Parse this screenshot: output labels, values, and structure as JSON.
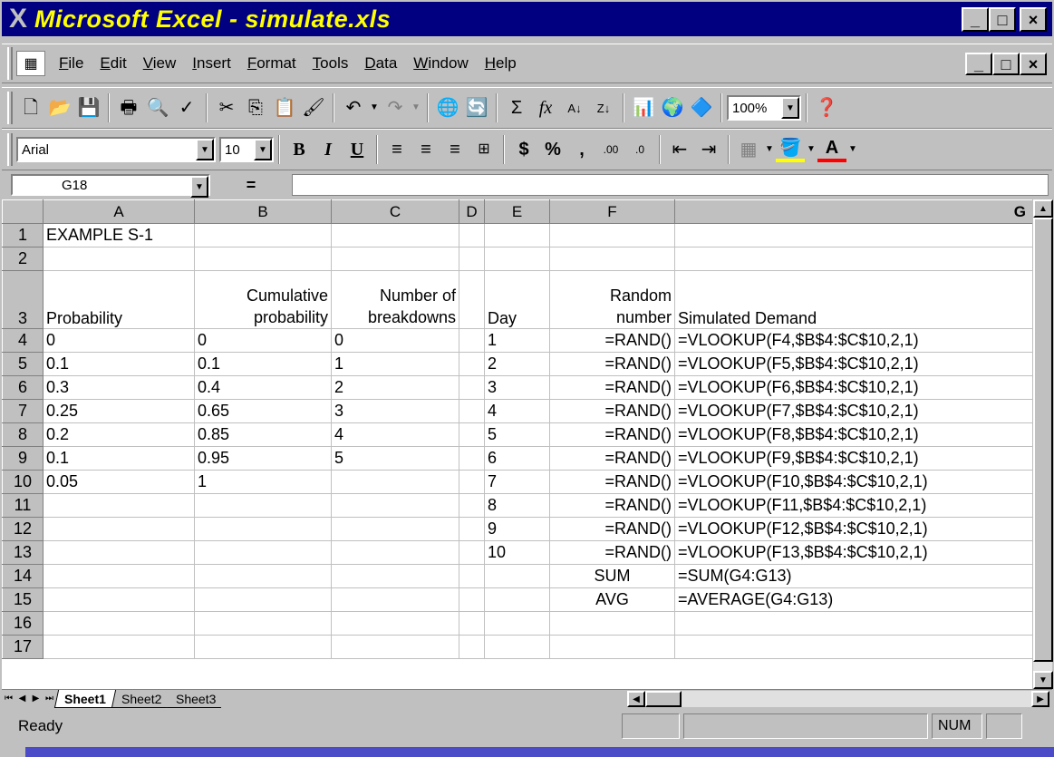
{
  "window": {
    "app_icon_glyph": "X",
    "title": "Microsoft Excel - simulate.xls",
    "caption_buttons": [
      "_",
      "□",
      "×"
    ]
  },
  "menubar": {
    "items": [
      "File",
      "Edit",
      "View",
      "Insert",
      "Format",
      "Tools",
      "Data",
      "Window",
      "Help"
    ]
  },
  "toolbar_standard": {
    "zoom": "100%"
  },
  "toolbar_formatting": {
    "font_name": "Arial",
    "font_size": "10",
    "bold": "B",
    "italic": "I",
    "underline": "U",
    "currency": "$",
    "percent": "%",
    "comma": ","
  },
  "formula_bar": {
    "name_box": "G18",
    "equals": "=",
    "content": ""
  },
  "columns": [
    "A",
    "B",
    "C",
    "D",
    "E",
    "F",
    "G"
  ],
  "rows": [
    {
      "num": "1",
      "cells": [
        "EXAMPLE S-1",
        "",
        "",
        "",
        "",
        "",
        ""
      ]
    },
    {
      "num": "2",
      "cells": [
        "",
        "",
        "",
        "",
        "",
        "",
        ""
      ]
    },
    {
      "num": "3",
      "cells": [
        "Probability",
        "Cumulative probability",
        "Number of breakdowns",
        "",
        "Day",
        "Random number",
        "Simulated Demand"
      ]
    },
    {
      "num": "4",
      "cells": [
        "0",
        "0",
        "0",
        "",
        "1",
        "=RAND()",
        "=VLOOKUP(F4,$B$4:$C$10,2,1)"
      ]
    },
    {
      "num": "5",
      "cells": [
        "0.1",
        "0.1",
        "1",
        "",
        "2",
        "=RAND()",
        "=VLOOKUP(F5,$B$4:$C$10,2,1)"
      ]
    },
    {
      "num": "6",
      "cells": [
        "0.3",
        "0.4",
        "2",
        "",
        "3",
        "=RAND()",
        "=VLOOKUP(F6,$B$4:$C$10,2,1)"
      ]
    },
    {
      "num": "7",
      "cells": [
        "0.25",
        "0.65",
        "3",
        "",
        "4",
        "=RAND()",
        "=VLOOKUP(F7,$B$4:$C$10,2,1)"
      ]
    },
    {
      "num": "8",
      "cells": [
        "0.2",
        "0.85",
        "4",
        "",
        "5",
        "=RAND()",
        "=VLOOKUP(F8,$B$4:$C$10,2,1)"
      ]
    },
    {
      "num": "9",
      "cells": [
        "0.1",
        "0.95",
        "5",
        "",
        "6",
        "=RAND()",
        "=VLOOKUP(F9,$B$4:$C$10,2,1)"
      ]
    },
    {
      "num": "10",
      "cells": [
        "0.05",
        "1",
        "",
        "",
        "7",
        "=RAND()",
        "=VLOOKUP(F10,$B$4:$C$10,2,1)"
      ]
    },
    {
      "num": "11",
      "cells": [
        "",
        "",
        "",
        "",
        "8",
        "=RAND()",
        "=VLOOKUP(F11,$B$4:$C$10,2,1)"
      ]
    },
    {
      "num": "12",
      "cells": [
        "",
        "",
        "",
        "",
        "9",
        "=RAND()",
        "=VLOOKUP(F12,$B$4:$C$10,2,1)"
      ]
    },
    {
      "num": "13",
      "cells": [
        "",
        "",
        "",
        "",
        "10",
        "=RAND()",
        "=VLOOKUP(F13,$B$4:$C$10,2,1)"
      ]
    },
    {
      "num": "14",
      "cells": [
        "",
        "",
        "",
        "",
        "",
        "SUM",
        "=SUM(G4:G13)"
      ]
    },
    {
      "num": "15",
      "cells": [
        "",
        "",
        "",
        "",
        "",
        "AVG",
        "=AVERAGE(G4:G13)"
      ]
    },
    {
      "num": "16",
      "cells": [
        "",
        "",
        "",
        "",
        "",
        "",
        ""
      ]
    },
    {
      "num": "17",
      "cells": [
        "",
        "",
        "",
        "",
        "",
        "",
        ""
      ]
    }
  ],
  "sheet_tabs": [
    "Sheet1",
    "Sheet2",
    "Sheet3"
  ],
  "statusbar": {
    "text": "Ready",
    "num_indicator": "NUM"
  }
}
